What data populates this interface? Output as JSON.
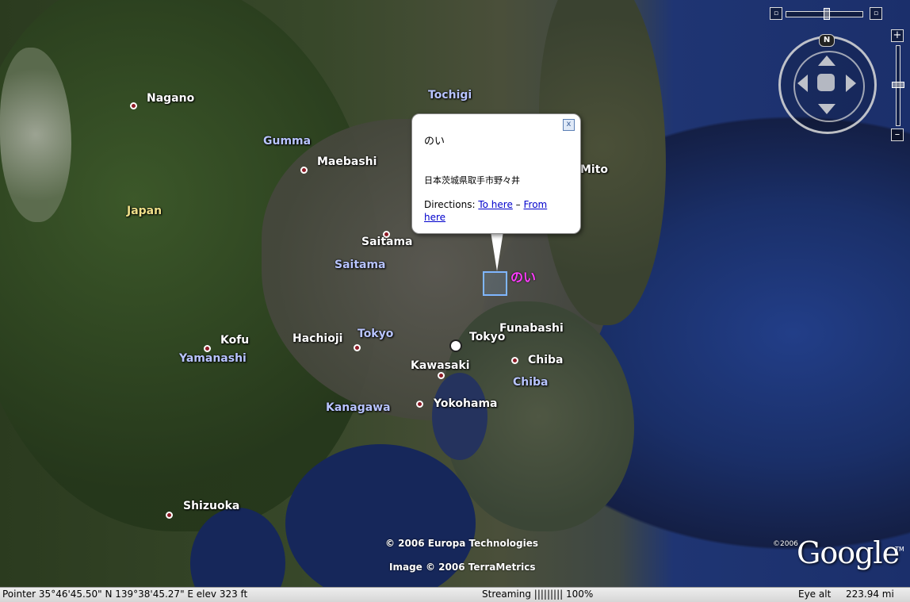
{
  "map": {
    "cities": [
      {
        "name": "Nagano"
      },
      {
        "name": "Maebashi"
      },
      {
        "name": "Saitama"
      },
      {
        "name": "Kofu"
      },
      {
        "name": "Hachioji"
      },
      {
        "name": "Tokyo"
      },
      {
        "name": "Funabashi"
      },
      {
        "name": "Chiba"
      },
      {
        "name": "Kawasaki"
      },
      {
        "name": "Yokohama"
      },
      {
        "name": "Shizuoka"
      },
      {
        "name": "Mito"
      }
    ],
    "prefectures": [
      {
        "name": "Tochigi"
      },
      {
        "name": "Gumma"
      },
      {
        "name": "Saitama"
      },
      {
        "name": "Tokyo"
      },
      {
        "name": "Yamanashi"
      },
      {
        "name": "Chiba"
      },
      {
        "name": "Kanagawa"
      }
    ],
    "country": "Japan",
    "placemark_label": "のい",
    "credits": {
      "line1": "© 2006 Europa Technologies",
      "line2": "Image © 2006 TerraMetrics"
    }
  },
  "balloon": {
    "title": "のい",
    "address": "日本茨城県取手市野々井",
    "directions_label": "Directions:",
    "to_here": "To here",
    "separator": "–",
    "from_here": "From here",
    "close": "x"
  },
  "controls": {
    "north": "N",
    "zoom_in": "+",
    "zoom_out": "–"
  },
  "branding": {
    "copyright": "©2006",
    "logo": "Google",
    "tm": "TM"
  },
  "status": {
    "pointer": "Pointer 35°46'45.50\" N  139°38'45.27\" E   elev   323 ft",
    "streaming": "Streaming ||||||||| 100%",
    "eye_alt_label": "Eye alt",
    "eye_alt_value": "223.94 mi"
  }
}
